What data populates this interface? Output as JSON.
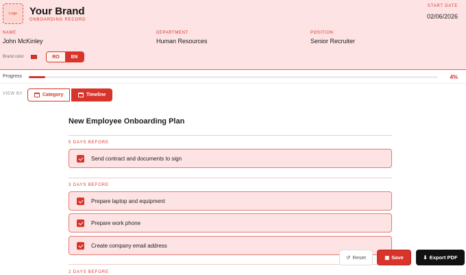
{
  "header": {
    "logo": "Logo",
    "brand_name": "Your Brand",
    "brand_sub": "ONBOARDING RECORD",
    "start_label": "START DATE",
    "start_date": "02/06/2026"
  },
  "fields": [
    {
      "label": "NAME",
      "value": "John McKinley"
    },
    {
      "label": "DEPARTMENT",
      "value": "Human Resources"
    },
    {
      "label": "POSITION",
      "value": "Senior Recruiter"
    }
  ],
  "brand_color": {
    "label": "Brand color",
    "value": "#d8342b"
  },
  "language": {
    "options": [
      "RO",
      "EN"
    ],
    "selected": "EN"
  },
  "progress": {
    "label": "Progress",
    "percent": 4,
    "text": "4%"
  },
  "view_by": {
    "label": "VIEW BY",
    "options": [
      "Category",
      "Timeline"
    ],
    "selected": "Timeline"
  },
  "plan": {
    "title": "New Employee Onboarding Plan",
    "sections": [
      {
        "label": "5 DAYS BEFORE",
        "tasks": [
          {
            "text": "Send contract and documents to sign",
            "checked": true
          }
        ]
      },
      {
        "label": "3 DAYS BEFORE",
        "tasks": [
          {
            "text": "Prepare laptop and equipment",
            "checked": true
          },
          {
            "text": "Prepare work phone",
            "checked": true
          },
          {
            "text": "Create company email address",
            "checked": true
          }
        ]
      },
      {
        "label": "2 DAYS BEFORE",
        "tasks": []
      }
    ]
  },
  "actions": {
    "reset": "Reset",
    "save": "Save",
    "export": "Export PDF"
  },
  "colors": {
    "accent": "#d8342b",
    "header_bg": "#fde3e3",
    "dark": "#111111"
  }
}
